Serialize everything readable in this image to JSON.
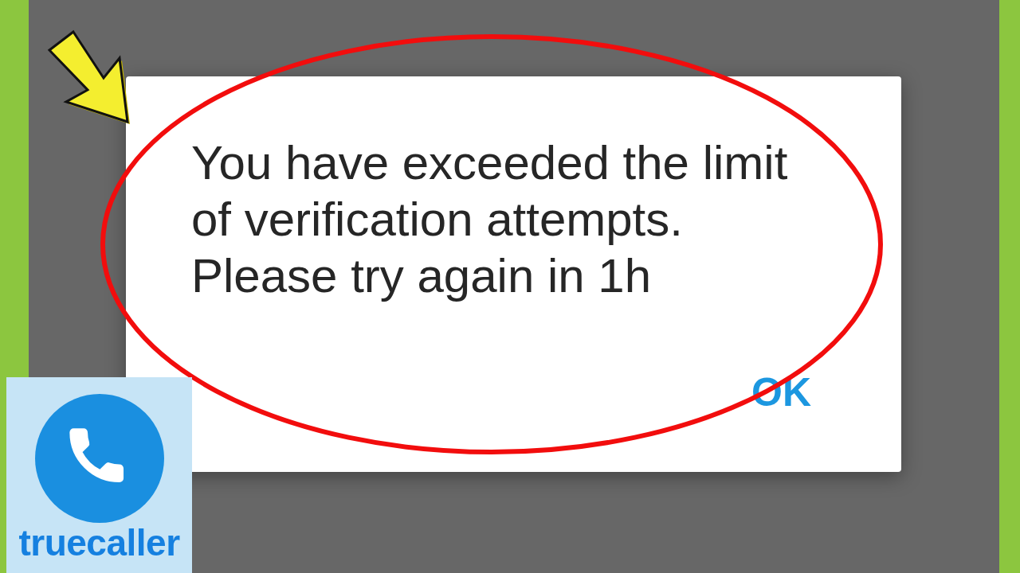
{
  "dialog": {
    "message": "You have exceeded the limit of verification attempts. Please try again in 1h",
    "buttons": [
      {
        "label": "OK"
      }
    ]
  },
  "logo": {
    "text": "truecaller"
  }
}
